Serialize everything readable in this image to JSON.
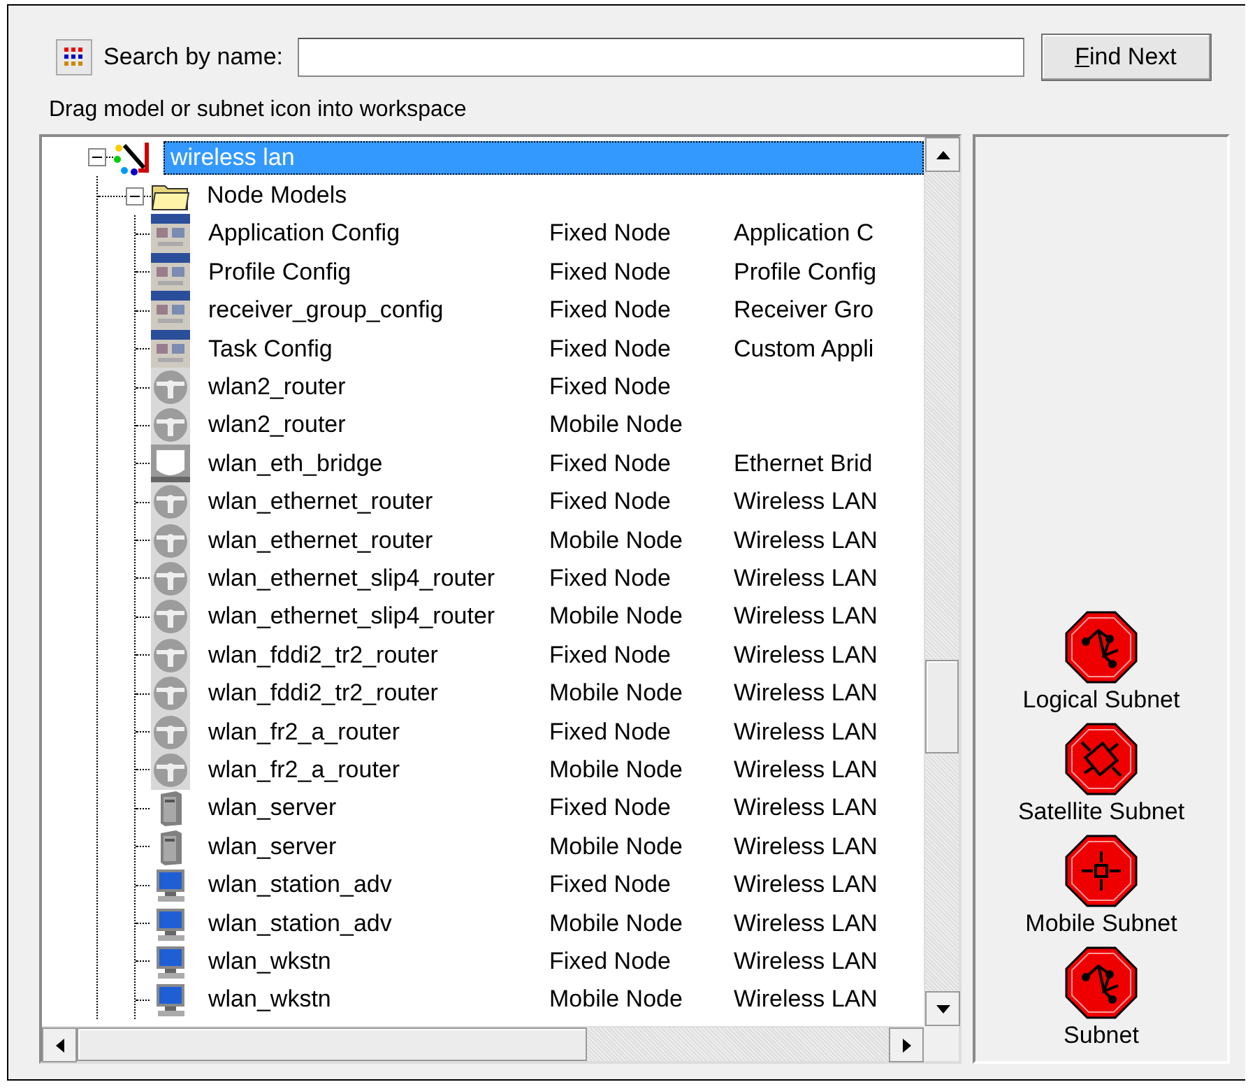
{
  "search": {
    "label": "Search by name:"
  },
  "find_button": {
    "label": "Find Next"
  },
  "hint": "Drag model or subnet icon into workspace",
  "tree": {
    "label": "wireless lan",
    "selected": true,
    "expanded": true,
    "children": [
      {
        "label": "Node Models",
        "selected": false,
        "expanded": true,
        "children": [
          {
            "name": "Application Config",
            "type": "Fixed Node",
            "description": "Application C",
            "kind": "config",
            "selected": false
          },
          {
            "name": "Profile Config",
            "type": "Fixed Node",
            "description": "Profile Config",
            "kind": "config",
            "selected": false
          },
          {
            "name": "receiver_group_config",
            "type": "Fixed Node",
            "description": "Receiver Gro",
            "kind": "config",
            "selected": false
          },
          {
            "name": "Task Config",
            "type": "Fixed Node",
            "description": "Custom Appli",
            "kind": "config",
            "selected": false
          },
          {
            "name": "wlan2_router",
            "type": "Fixed Node",
            "kind": "router",
            "selected": false
          },
          {
            "name": "wlan2_router",
            "type": "Mobile Node",
            "kind": "router",
            "selected": false
          },
          {
            "name": "wlan_eth_bridge",
            "type": "Fixed Node",
            "description": "Ethernet Brid",
            "kind": "bridge",
            "selected": false
          },
          {
            "name": "wlan_ethernet_router",
            "type": "Fixed Node",
            "description": "Wireless LAN",
            "kind": "router",
            "selected": false
          },
          {
            "name": "wlan_ethernet_router",
            "type": "Mobile Node",
            "description": "Wireless LAN",
            "kind": "router",
            "selected": false
          },
          {
            "name": "wlan_ethernet_slip4_router",
            "type": "Fixed Node",
            "description": "Wireless LAN",
            "kind": "router",
            "selected": false
          },
          {
            "name": "wlan_ethernet_slip4_router",
            "type": "Mobile Node",
            "description": "Wireless LAN",
            "kind": "router",
            "selected": false
          },
          {
            "name": "wlan_fddi2_tr2_router",
            "type": "Fixed Node",
            "description": "Wireless LAN",
            "kind": "router",
            "selected": false
          },
          {
            "name": "wlan_fddi2_tr2_router",
            "type": "Mobile Node",
            "description": "Wireless LAN",
            "kind": "router",
            "selected": false
          },
          {
            "name": "wlan_fr2_a_router",
            "type": "Fixed Node",
            "description": "Wireless LAN",
            "kind": "router",
            "selected": false
          },
          {
            "name": "wlan_fr2_a_router",
            "type": "Mobile Node",
            "description": "Wireless LAN",
            "kind": "router",
            "selected": false
          },
          {
            "name": "wlan_server",
            "type": "Fixed Node",
            "description": "Wireless LAN",
            "kind": "server",
            "selected": false
          },
          {
            "name": "wlan_server",
            "type": "Mobile Node",
            "description": "Wireless LAN",
            "kind": "server",
            "selected": false
          },
          {
            "name": "wlan_station_adv",
            "type": "Fixed Node",
            "description": "Wireless LAN",
            "kind": "workstation",
            "selected": false
          },
          {
            "name": "wlan_station_adv",
            "type": "Mobile Node",
            "description": "Wireless LAN",
            "kind": "workstation",
            "selected": false
          },
          {
            "name": "wlan_wkstn",
            "type": "Fixed Node",
            "description": "Wireless LAN",
            "kind": "workstation",
            "selected": false
          },
          {
            "name": "wlan_wkstn",
            "type": "Mobile Node",
            "description": "Wireless LAN",
            "kind": "workstation",
            "selected": false
          }
        ]
      }
    ]
  },
  "subnets": [
    {
      "label": "Logical Subnet",
      "kind": "logical"
    },
    {
      "label": "Satellite Subnet",
      "kind": "satellite"
    },
    {
      "label": "Mobile Subnet",
      "kind": "mobile"
    },
    {
      "label": "Subnet",
      "kind": "logical"
    }
  ]
}
